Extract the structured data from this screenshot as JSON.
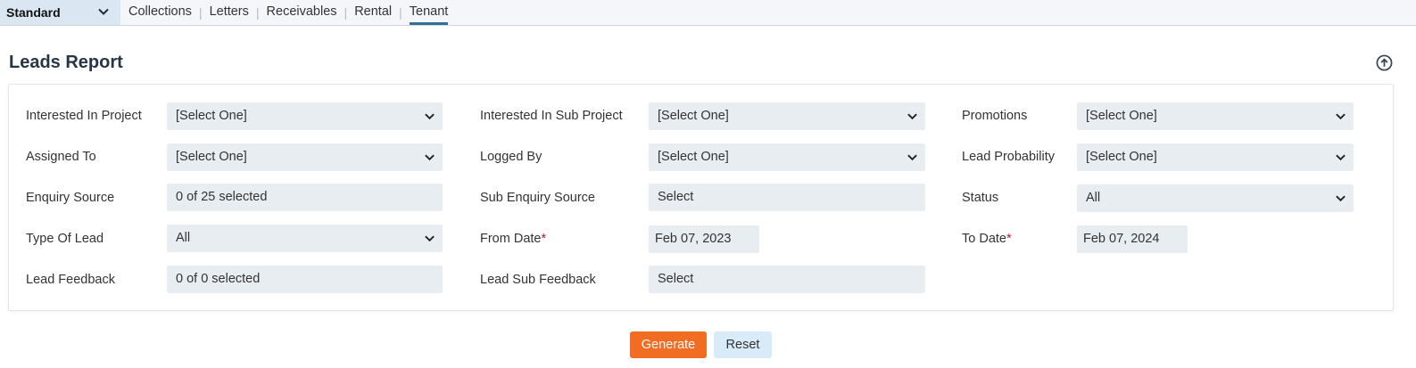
{
  "header": {
    "mode_select": {
      "value": "Standard",
      "icon": "chevron-down-icon"
    },
    "tabs": [
      {
        "label": "Collections",
        "active": false
      },
      {
        "label": "Letters",
        "active": false
      },
      {
        "label": "Receivables",
        "active": false
      },
      {
        "label": "Rental",
        "active": false
      },
      {
        "label": "Tenant",
        "active": true
      }
    ]
  },
  "page": {
    "title": "Leads Report",
    "collapse_icon": "arrow-up-circle-icon"
  },
  "form": {
    "interested_in_project": {
      "label": "Interested In Project",
      "value": "[Select One]"
    },
    "interested_in_sub_project": {
      "label": "Interested In Sub Project",
      "value": "[Select One]"
    },
    "promotions": {
      "label": "Promotions",
      "value": "[Select One]"
    },
    "assigned_to": {
      "label": "Assigned To",
      "value": "[Select One]"
    },
    "logged_by": {
      "label": "Logged By",
      "value": "[Select One]"
    },
    "lead_probability": {
      "label": "Lead Probability",
      "value": "[Select One]"
    },
    "enquiry_source": {
      "label": "Enquiry Source",
      "value": "0 of 25 selected"
    },
    "sub_enquiry_source": {
      "label": "Sub Enquiry Source",
      "value": "Select"
    },
    "status": {
      "label": "Status",
      "value": "All"
    },
    "type_of_lead": {
      "label": "Type Of Lead",
      "value": "All"
    },
    "from_date": {
      "label": "From Date",
      "required_mark": "*",
      "value": "Feb 07, 2023"
    },
    "to_date": {
      "label": "To Date",
      "required_mark": "*",
      "value": "Feb 07, 2024"
    },
    "lead_feedback": {
      "label": "Lead Feedback",
      "value": "0 of 0 selected"
    },
    "lead_sub_feedback": {
      "label": "Lead Sub Feedback",
      "value": "Select"
    }
  },
  "actions": {
    "generate_label": "Generate",
    "reset_label": "Reset"
  },
  "colors": {
    "primary_button": "#f06d23",
    "secondary_button": "#d9eaf8",
    "field_background": "#e8edf2",
    "active_tab_underline": "#2f6f9b",
    "required": "#c0152a"
  }
}
